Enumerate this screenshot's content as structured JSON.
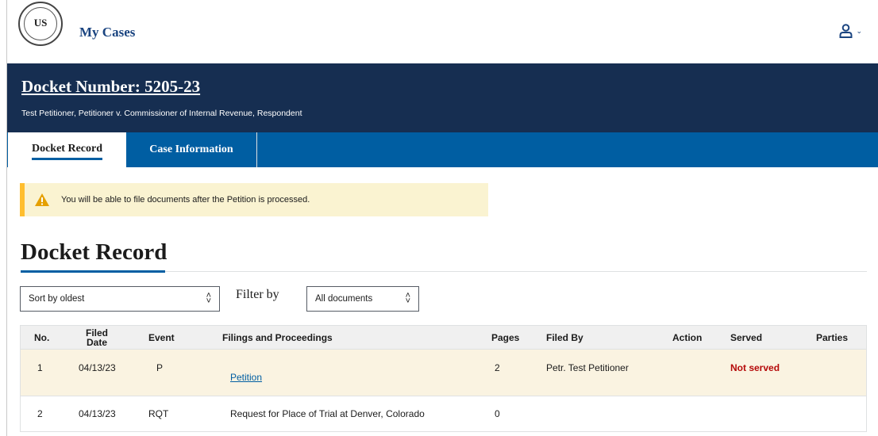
{
  "header": {
    "seal_text": "US",
    "brand_link": "My Cases"
  },
  "banner": {
    "docket_title": "Docket Number: 5205-23",
    "caption": "Test Petitioner, Petitioner v. Commissioner of Internal Revenue, Respondent"
  },
  "tabs": [
    {
      "label": "Docket Record",
      "active": true
    },
    {
      "label": "Case Information",
      "active": false
    }
  ],
  "alert": {
    "message": "You will be able to file documents after the Petition is processed."
  },
  "main": {
    "heading": "Docket Record",
    "sort": {
      "value": "Sort by oldest"
    },
    "filter_label": "Filter by",
    "filter": {
      "value": "All documents"
    }
  },
  "table": {
    "columns": {
      "no": "No.",
      "filed_date": "Filed Date",
      "event": "Event",
      "filings": "Filings and Proceedings",
      "pages": "Pages",
      "filed_by": "Filed By",
      "action": "Action",
      "served": "Served",
      "parties": "Parties"
    },
    "rows": [
      {
        "no": "1",
        "filed_date": "04/13/23",
        "event": "P",
        "filing": "Petition",
        "pages": "2",
        "filed_by": "Petr. Test Petitioner",
        "action": "",
        "served": "Not served",
        "parties": ""
      },
      {
        "no": "2",
        "filed_date": "04/13/23",
        "event": "RQT",
        "filing": "Request for Place of Trial at Denver, Colorado",
        "pages": "0",
        "filed_by": "",
        "action": "",
        "served": "",
        "parties": ""
      }
    ]
  },
  "colors": {
    "banner": "#162e51",
    "tabs": "#005ea2",
    "alert_bg": "#faf3d1",
    "alert_accent": "#ffbe2e",
    "link": "#005ea2",
    "not_served": "#b50909"
  },
  "icons": {
    "user": "user-icon",
    "warning": "warning-icon"
  }
}
